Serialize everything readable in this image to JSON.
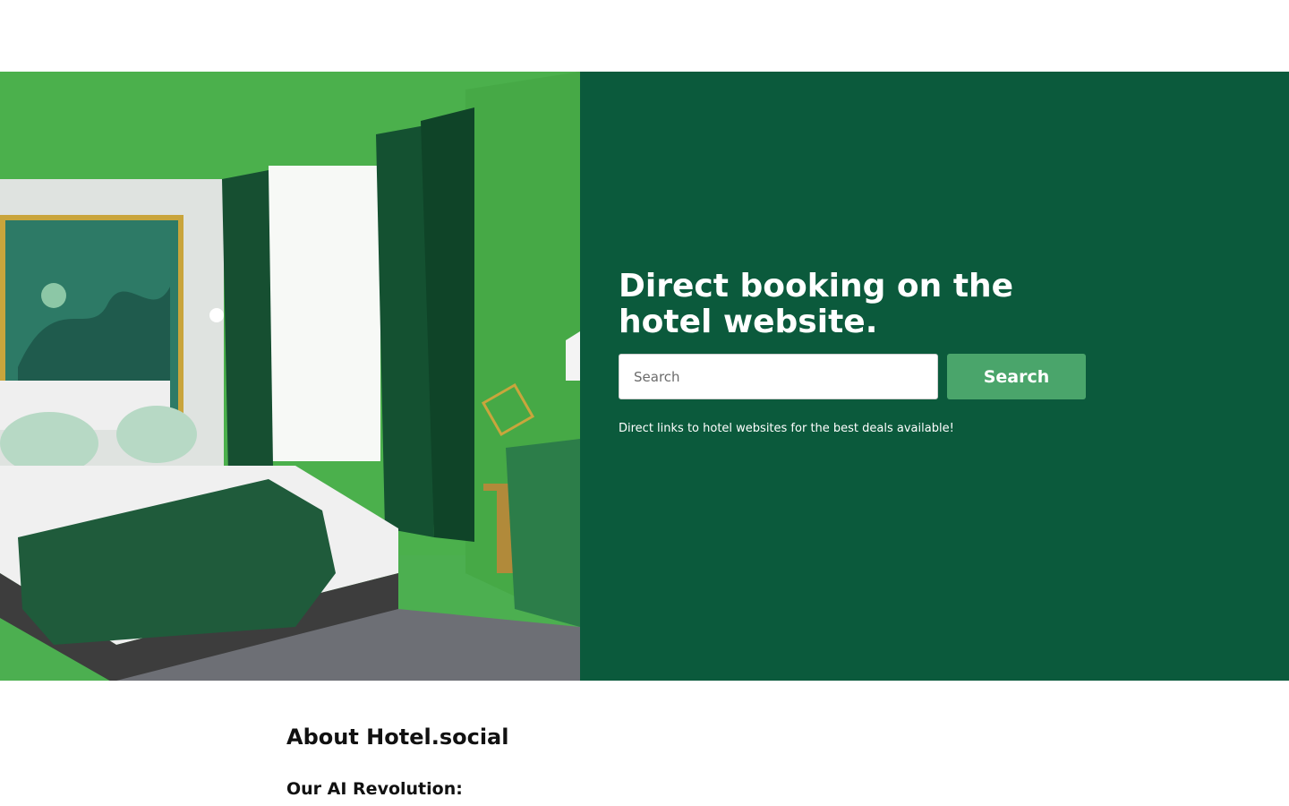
{
  "hero": {
    "image_alt": "Hotel room with green walls, dark green curtains, artwork and a made bed",
    "title": "Direct booking on the hotel website.",
    "search": {
      "placeholder": "Search",
      "value": "",
      "button_label": "Search"
    },
    "tagline": "Direct links to hotel websites for the best deals available!"
  },
  "about": {
    "title": "About Hotel.social",
    "subtitle": "Our AI Revolution:"
  },
  "colors": {
    "panel": "#0b5a3c",
    "button": "#4aa56b",
    "wall_green": "#4caf50"
  }
}
